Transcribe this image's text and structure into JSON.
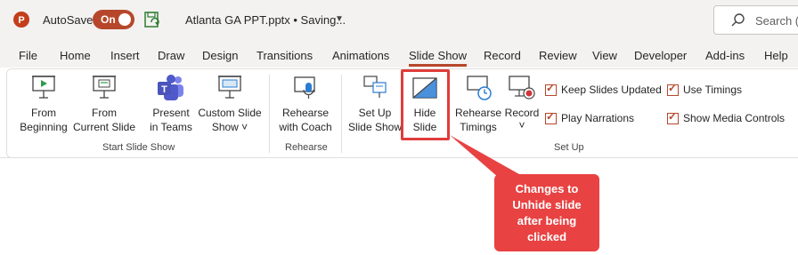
{
  "titlebar": {
    "autosave_label": "AutoSave",
    "autosave_state": "On",
    "document_title": "Atlanta GA PPT.pptx • Saving...",
    "search_placeholder": "Search (",
    "accent_color": "#b7472a"
  },
  "menu": {
    "tabs": [
      "File",
      "Home",
      "Insert",
      "Draw",
      "Design",
      "Transitions",
      "Animations",
      "Slide Show",
      "Record",
      "Review",
      "View",
      "Developer",
      "Add-ins",
      "Help"
    ],
    "active_tab": "Slide Show"
  },
  "ribbon": {
    "start_slide_show": {
      "group_label": "Start Slide Show",
      "from_beginning": [
        "From",
        "Beginning"
      ],
      "from_current": [
        "From",
        "Current Slide"
      ],
      "present_teams": [
        "Present",
        "in Teams"
      ],
      "custom_show": [
        "Custom Slide",
        "Show ˅"
      ]
    },
    "rehearse": {
      "group_label": "Rehearse",
      "rehearse_coach": [
        "Rehearse",
        "with Coach"
      ]
    },
    "setup": {
      "group_label": "Set Up",
      "setup_show": [
        "Set Up",
        "Slide Show"
      ],
      "hide_slide": [
        "Hide",
        "Slide"
      ],
      "rehearse_timings": [
        "Rehearse",
        "Timings"
      ],
      "record": [
        "Record",
        "˅"
      ],
      "keep_slides_updated": "Keep Slides Updated",
      "play_narrations": "Play Narrations",
      "use_timings": "Use Timings",
      "show_media_controls": "Show Media Controls"
    }
  },
  "callout": {
    "lines": [
      "Changes to",
      "Unhide slide",
      "after being",
      "clicked"
    ],
    "color": "#e84242"
  }
}
